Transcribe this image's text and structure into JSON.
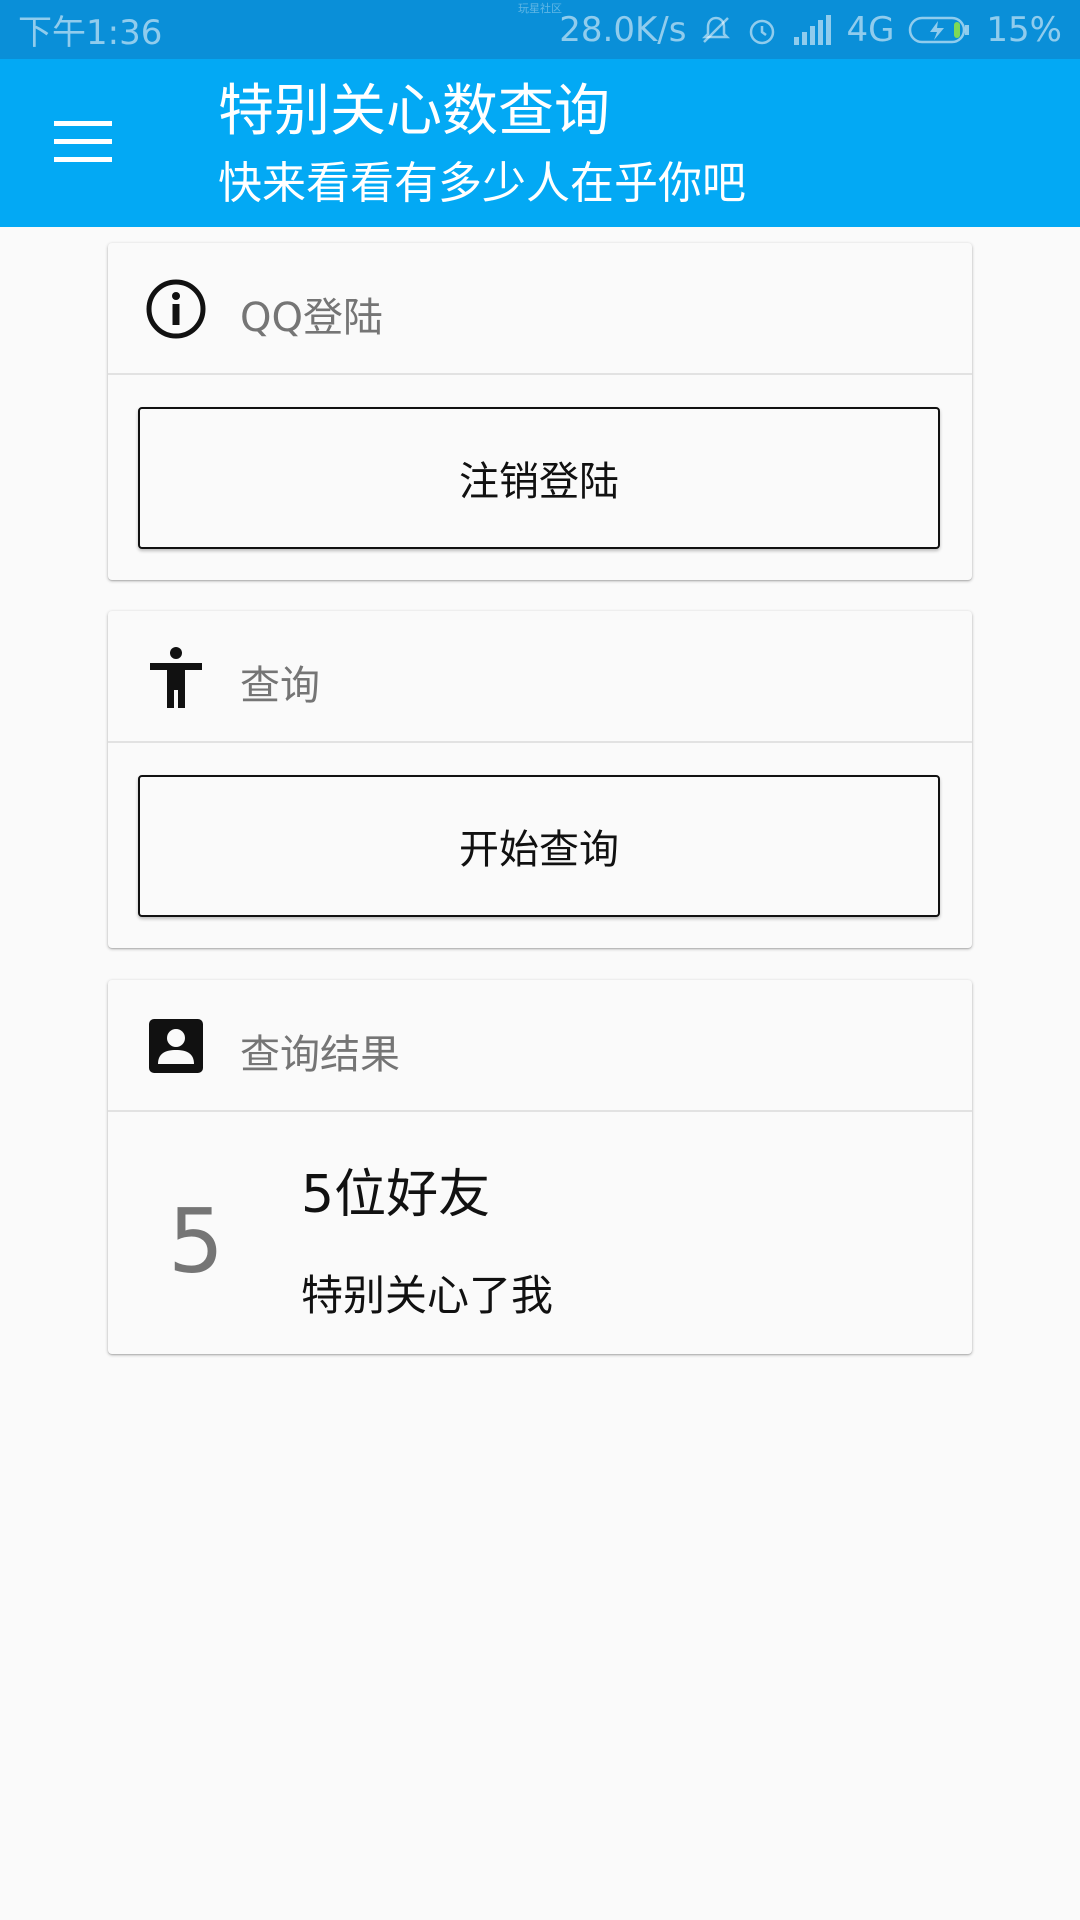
{
  "status_bar": {
    "time": "下午1:36",
    "watermark": "玩星社区",
    "net_speed": "28.0K/s",
    "network": "4G",
    "battery": "15%"
  },
  "app_bar": {
    "title": "特别关心数查询",
    "subtitle": "快来看看有多少人在乎你吧"
  },
  "cards": {
    "login": {
      "icon": "info-icon",
      "title": "QQ登陆",
      "button_label": "注销登陆"
    },
    "query": {
      "icon": "accessibility-icon",
      "title": "查询",
      "button_label": "开始查询"
    },
    "result": {
      "icon": "contact-icon",
      "title": "查询结果",
      "count": "5",
      "line1": "5位好友",
      "line2": "特别关心了我"
    }
  },
  "colors": {
    "status_bar": "#0a8fd8",
    "app_bar": "#03a9f4",
    "background": "#fafafa"
  }
}
